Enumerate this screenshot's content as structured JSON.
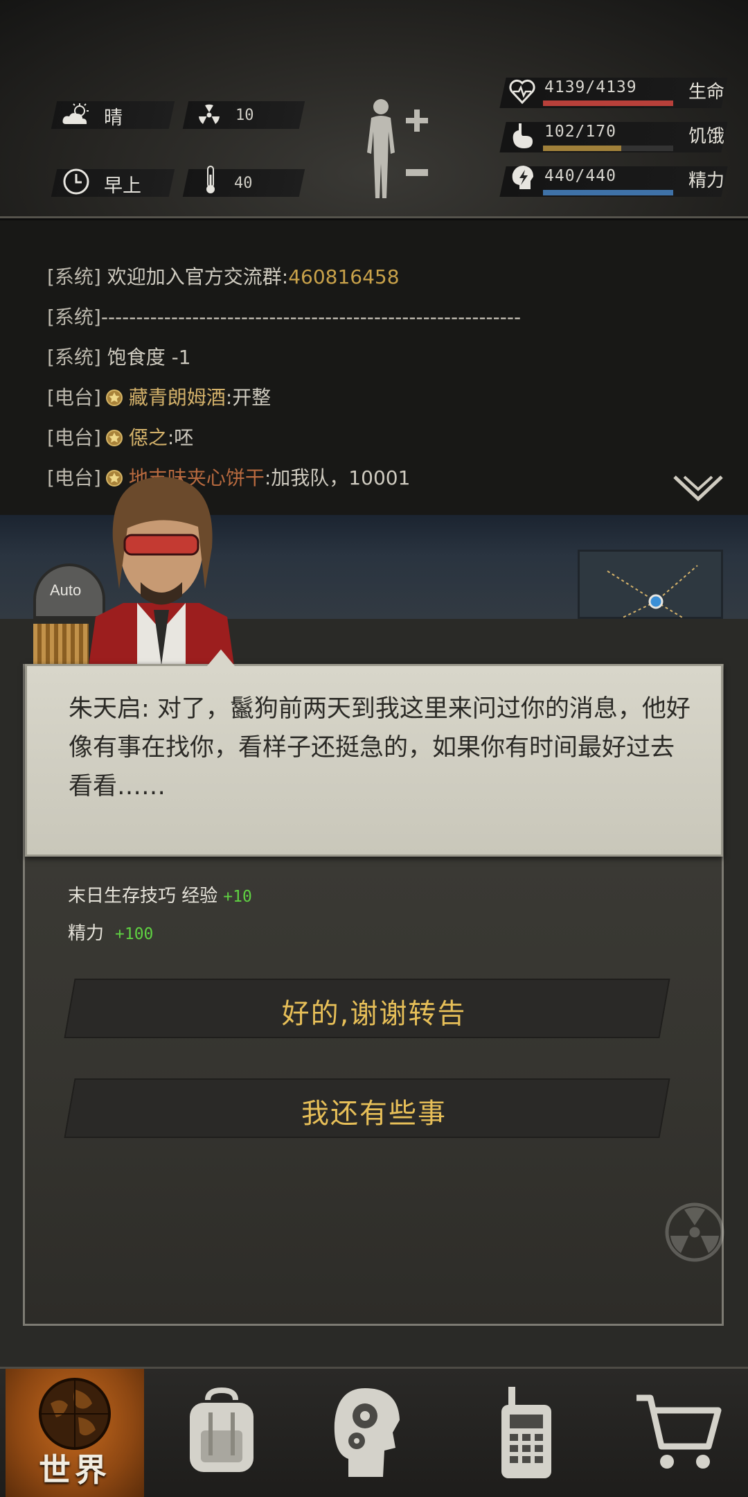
{
  "environment": {
    "weather": "晴",
    "radiation": "10",
    "time_of_day": "早上",
    "temperature": "40"
  },
  "stats": [
    {
      "label": "生命",
      "value": "4139/4139",
      "fill_fraction": 1.0,
      "color": "#b8403a",
      "icon": "heart-pulse-icon"
    },
    {
      "label": "饥饿",
      "value": "102/170",
      "fill_fraction": 0.6,
      "color": "#a0803a",
      "icon": "stomach-icon"
    },
    {
      "label": "精力",
      "value": "440/440",
      "fill_fraction": 1.0,
      "color": "#3f72a8",
      "icon": "energy-head-icon"
    }
  ],
  "chat": {
    "lines": [
      {
        "tag": "[系统]",
        "text": " 欢迎加入官方交流群:",
        "highlight": "460816458"
      },
      {
        "tag": "[系统]",
        "text": "------------------------------------------------------------"
      },
      {
        "tag": "[系统]",
        "text": " 饱食度 -1"
      },
      {
        "tag": "[电台]",
        "name": "藏青朗姆酒",
        "text": ":开整"
      },
      {
        "tag": "[电台]",
        "name": "僫之",
        "text": ":呸"
      },
      {
        "tag": "[电台]",
        "name": "地支味夹心饼干",
        "text": ":加我队，10001"
      }
    ]
  },
  "dialog": {
    "speaker_text": "朱天启: 对了，鬣狗前两天到我这里来问过你的消息，他好像有事在找你，看样子还挺急的，如果你有时间最好过去看看……"
  },
  "rewards": [
    {
      "label": "末日生存技巧 经验",
      "amount": "+10"
    },
    {
      "label": "精力",
      "amount": "+100"
    }
  ],
  "choices": [
    {
      "label": "好的,谢谢转告"
    },
    {
      "label": "我还有些事"
    }
  ],
  "auto_label": "Auto",
  "nav": {
    "world_label": "世界",
    "items": [
      "world-globe-icon",
      "backpack-icon",
      "skills-head-icon",
      "radio-walkie-icon",
      "shop-cart-icon"
    ]
  }
}
